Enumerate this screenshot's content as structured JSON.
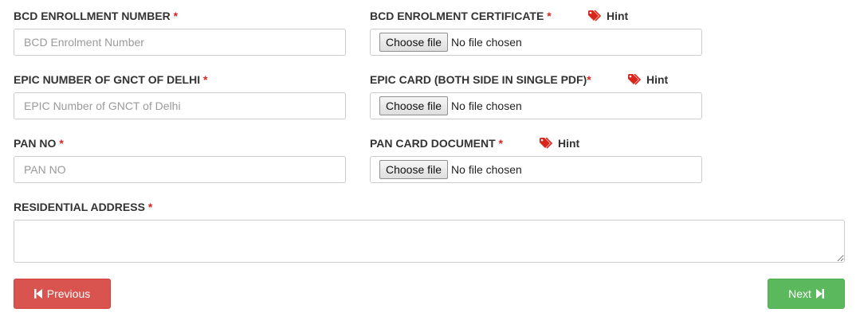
{
  "fields": {
    "bcd_number": {
      "label": "BCD ENROLLMENT NUMBER",
      "required": "*",
      "placeholder": "BCD Enrolment Number"
    },
    "bcd_certificate": {
      "label": "BCD ENROLMENT CERTIFICATE",
      "required": "*",
      "button": "Choose file",
      "status": "No file chosen",
      "hint": "Hint"
    },
    "epic_number": {
      "label": "EPIC NUMBER OF GNCT OF DELHI",
      "required": "*",
      "placeholder": "EPIC Number of GNCT of Delhi"
    },
    "epic_card": {
      "label": "EPIC CARD (BOTH SIDE IN SINGLE PDF)",
      "required": "*",
      "button": "Choose file",
      "status": "No file chosen",
      "hint": "Hint"
    },
    "pan_no": {
      "label": "PAN NO",
      "required": "*",
      "placeholder": "PAN NO"
    },
    "pan_card": {
      "label": "PAN CARD DOCUMENT",
      "required": "*",
      "button": "Choose file",
      "status": "No file chosen",
      "hint": "Hint"
    },
    "residential_address": {
      "label": "RESIDENTIAL ADDRESS",
      "required": "*",
      "value": ""
    }
  },
  "buttons": {
    "previous": "Previous",
    "next": "Next"
  },
  "icons": {
    "hint": "tags-icon",
    "previous": "step-backward-icon",
    "next": "step-forward-icon"
  },
  "colors": {
    "required": "#d9261c",
    "hint_icon": "#d9261c",
    "previous_bg": "#d9534f",
    "next_bg": "#5cb85c"
  }
}
